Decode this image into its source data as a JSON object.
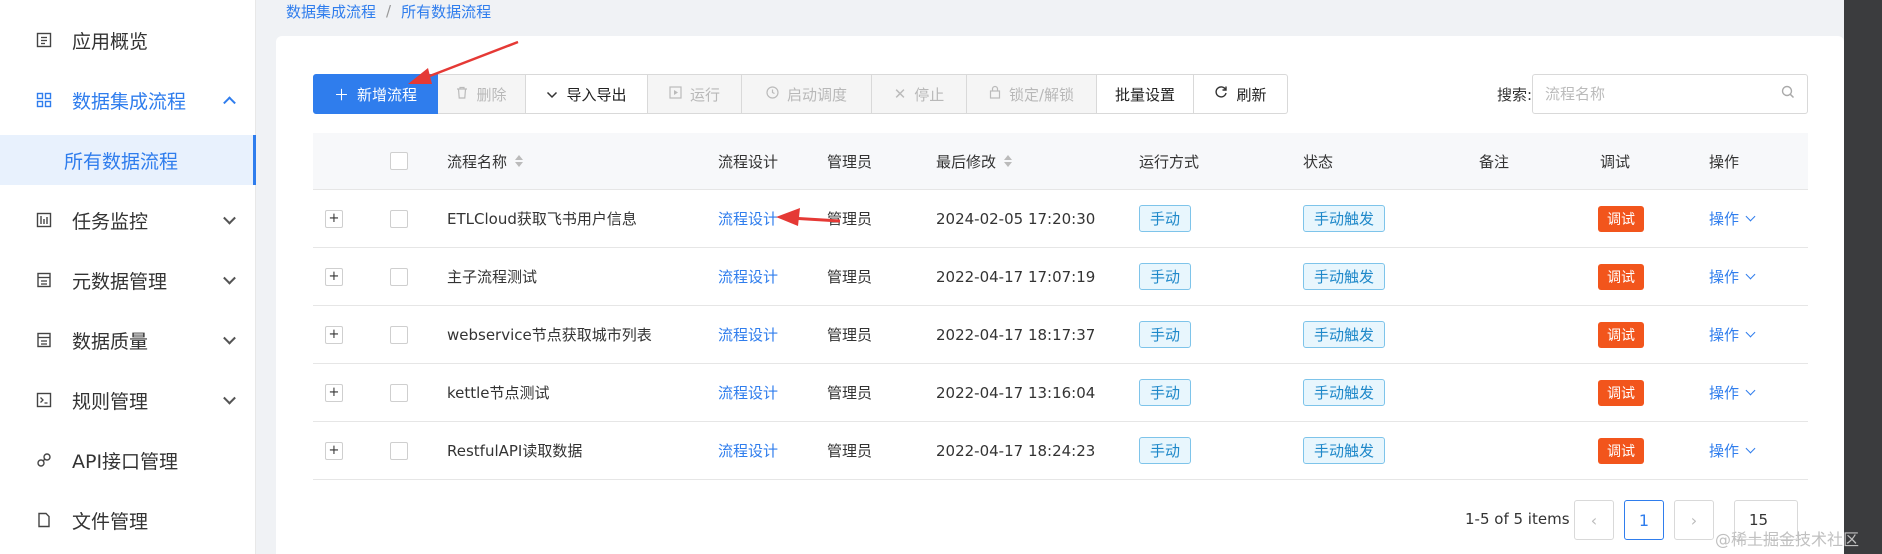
{
  "sidebar": {
    "items": [
      {
        "label": "应用概览",
        "icon": "overview-icon",
        "has_chevron": false,
        "open": false
      },
      {
        "label": "数据集成流程",
        "icon": "grid-icon",
        "has_chevron": true,
        "open": true
      },
      {
        "label": "任务监控",
        "icon": "monitor-icon",
        "has_chevron": true,
        "open": false
      },
      {
        "label": "元数据管理",
        "icon": "metadata-icon",
        "has_chevron": true,
        "open": false
      },
      {
        "label": "数据质量",
        "icon": "quality-icon",
        "has_chevron": true,
        "open": false
      },
      {
        "label": "规则管理",
        "icon": "rules-icon",
        "has_chevron": true,
        "open": false
      },
      {
        "label": "API接口管理",
        "icon": "api-icon",
        "has_chevron": false,
        "open": false
      },
      {
        "label": "文件管理",
        "icon": "file-icon",
        "has_chevron": false,
        "open": false
      }
    ],
    "active_sub": "所有数据流程"
  },
  "breadcrumb": {
    "parent": "数据集成流程",
    "separator": "/",
    "current": "所有数据流程"
  },
  "toolbar": {
    "add": "新增流程",
    "delete": "删除",
    "import_export": "导入导出",
    "run": "运行",
    "schedule": "启动调度",
    "stop": "停止",
    "lock": "锁定/解锁",
    "batch": "批量设置",
    "refresh": "刷新"
  },
  "search": {
    "label": "搜索:",
    "placeholder": "流程名称"
  },
  "table": {
    "headers": {
      "name": "流程名称",
      "design": "流程设计",
      "admin": "管理员",
      "modified": "最后修改",
      "run_mode": "运行方式",
      "status": "状态",
      "remark": "备注",
      "debug": "调试",
      "action": "操作"
    },
    "rows": [
      {
        "name": "ETLCloud获取飞书用户信息",
        "design": "流程设计",
        "admin": "管理员",
        "modified": "2024-02-05 17:20:30",
        "run_mode": "手动",
        "status": "手动触发",
        "remark": "",
        "debug": "调试",
        "action": "操作"
      },
      {
        "name": "主子流程测试",
        "design": "流程设计",
        "admin": "管理员",
        "modified": "2022-04-17 17:07:19",
        "run_mode": "手动",
        "status": "手动触发",
        "remark": "",
        "debug": "调试",
        "action": "操作"
      },
      {
        "name": "webservice节点获取城市列表",
        "design": "流程设计",
        "admin": "管理员",
        "modified": "2022-04-17 18:17:37",
        "run_mode": "手动",
        "status": "手动触发",
        "remark": "",
        "debug": "调试",
        "action": "操作"
      },
      {
        "name": "kettle节点测试",
        "design": "流程设计",
        "admin": "管理员",
        "modified": "2022-04-17 13:16:04",
        "run_mode": "手动",
        "status": "手动触发",
        "remark": "",
        "debug": "调试",
        "action": "操作"
      },
      {
        "name": "RestfulAPI读取数据",
        "design": "流程设计",
        "admin": "管理员",
        "modified": "2022-04-17 18:24:23",
        "run_mode": "手动",
        "status": "手动触发",
        "remark": "",
        "debug": "调试",
        "action": "操作"
      }
    ]
  },
  "pagination": {
    "total_text": "1-5 of 5 items",
    "current_page": "1",
    "page_size": "15",
    "prev": "‹",
    "next": "›"
  },
  "watermark": "@稀土掘金技术社区",
  "colors": {
    "primary": "#2f7ded",
    "debug_tag": "#f2551c",
    "blue_tag": "#1e88c9",
    "annotation_arrow": "#e53935"
  }
}
